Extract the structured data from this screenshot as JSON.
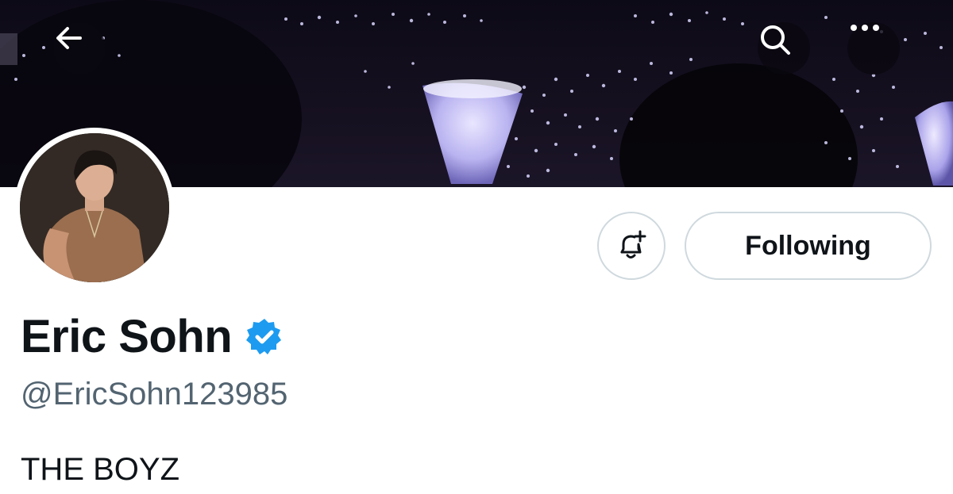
{
  "header": {
    "back_icon": "arrow-left-icon",
    "search_icon": "search-icon",
    "more_icon": "more-horizontal-icon"
  },
  "profile": {
    "display_name": "Eric Sohn",
    "verified_icon": "verified-badge-icon",
    "verified_color": "#1d9bf0",
    "handle": "@EricSohn123985",
    "bio": "THE BOYZ"
  },
  "actions": {
    "notify_icon": "bell-plus-icon",
    "following_label": "Following"
  },
  "colors": {
    "text_primary": "#0f1419",
    "text_secondary": "#536471",
    "border": "#cfd9de",
    "accent": "#1d9bf0"
  }
}
